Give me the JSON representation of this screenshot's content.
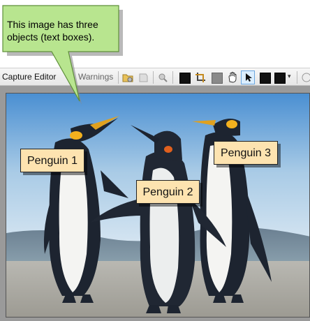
{
  "callout": {
    "text": "This image has three objects (text boxes)."
  },
  "toolbar": {
    "tab_capture_editor": "Capture Editor",
    "tab_warnings": "Warnings",
    "colors": {
      "swatch_black": "#111111",
      "swatch_gray": "#8a8a8a",
      "swatch_black2": "#111111"
    }
  },
  "canvas": {
    "labels": {
      "penguin1": "Penguin 1",
      "penguin2": "Penguin 2",
      "penguin3": "Penguin 3"
    }
  }
}
